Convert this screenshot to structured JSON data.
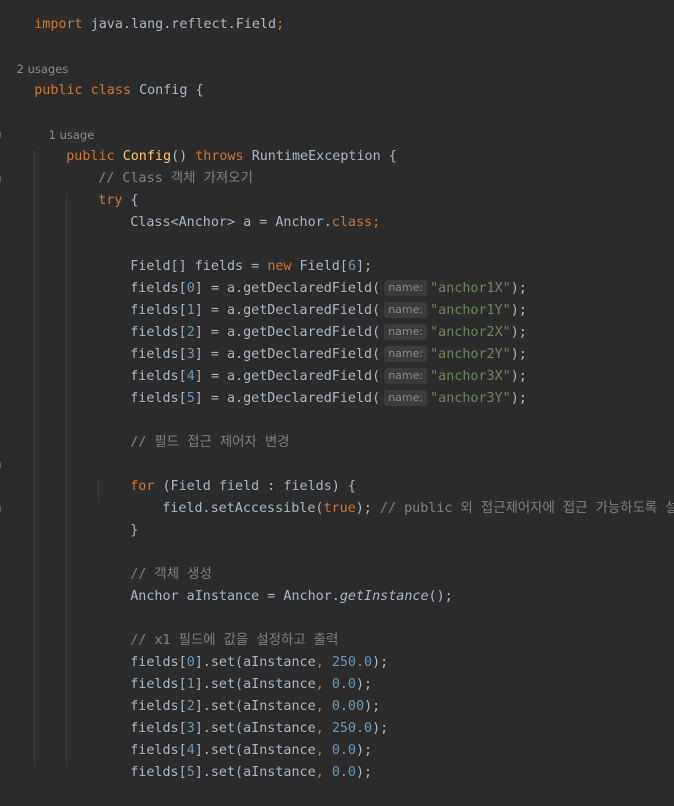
{
  "code": {
    "import_kw": "import",
    "import_path": "java.lang.reflect.Field",
    "import_semi": ";",
    "usages_class": "2 usages",
    "class_decl_kw": "public class",
    "class_name": "Config",
    "class_brace": "{",
    "usages_ctor": "1 usage",
    "ctor_public": "public",
    "ctor_name": "Config",
    "ctor_parens": "()",
    "ctor_throws": "throws",
    "ctor_exception": "RuntimeException {",
    "comment_get_class": "// Class 객체 가져오기",
    "try_kw": "try",
    "try_brace": "{",
    "class_line": "Class<Anchor> a = Anchor.",
    "class_kw": "class",
    "semi": ";",
    "fields_decl": "Field[] fields = ",
    "new_kw": "new",
    "fields_new": " Field[",
    "fields_size": "6",
    "fields_end": "];",
    "param_hint": "name:",
    "declared_fields": [
      {
        "prefix": "fields[",
        "index": "0",
        "mid": "] = a.getDeclaredField(",
        "arg": "\"anchor1X\"",
        "end": ");"
      },
      {
        "prefix": "fields[",
        "index": "1",
        "mid": "] = a.getDeclaredField(",
        "arg": "\"anchor1Y\"",
        "end": ");"
      },
      {
        "prefix": "fields[",
        "index": "2",
        "mid": "] = a.getDeclaredField(",
        "arg": "\"anchor2X\"",
        "end": ");"
      },
      {
        "prefix": "fields[",
        "index": "3",
        "mid": "] = a.getDeclaredField(",
        "arg": "\"anchor2Y\"",
        "end": ");"
      },
      {
        "prefix": "fields[",
        "index": "4",
        "mid": "] = a.getDeclaredField(",
        "arg": "\"anchor3X\"",
        "end": ");"
      },
      {
        "prefix": "fields[",
        "index": "5",
        "mid": "] = a.getDeclaredField(",
        "arg": "\"anchor3Y\"",
        "end": ");"
      }
    ],
    "comment_access": "// 필드 접근 제어자 변경",
    "for_kw": "for",
    "for_rest": " (Field field : fields) {",
    "set_accessible": "field.setAccessible(",
    "true_kw": "true",
    "set_accessible_end": ");",
    "comment_accessible": " // public 외 접근제어자에 접근 가능하도록 설정",
    "close_brace": "}",
    "comment_instance": "// 객체 생성",
    "instance_start": "Anchor aInstance = Anchor.",
    "instance_method": "getInstance",
    "instance_end": "();",
    "comment_set": "// x1 필드에 값을 설정하고 출력",
    "set_lines": [
      {
        "prefix": "fields[",
        "index": "0",
        "mid": "].set(aInstance",
        "comma": ", ",
        "value": "250.0",
        "end": ");"
      },
      {
        "prefix": "fields[",
        "index": "1",
        "mid": "].set(aInstance",
        "comma": ", ",
        "value": "0.0",
        "end": ");"
      },
      {
        "prefix": "fields[",
        "index": "2",
        "mid": "].set(aInstance",
        "comma": ", ",
        "value": "0.00",
        "end": ");"
      },
      {
        "prefix": "fields[",
        "index": "3",
        "mid": "].set(aInstance",
        "comma": ", ",
        "value": "250.0",
        "end": ");"
      },
      {
        "prefix": "fields[",
        "index": "4",
        "mid": "].set(aInstance",
        "comma": ", ",
        "value": "0.0",
        "end": ");"
      },
      {
        "prefix": "fields[",
        "index": "5",
        "mid": "].set(aInstance",
        "comma": ", ",
        "value": "0.0",
        "end": ");"
      }
    ]
  },
  "colors": {
    "background": "#2b2b2b",
    "keyword": "#cc7832",
    "function": "#ffc66d",
    "string": "#6a8759",
    "number": "#6897bb",
    "comment": "#808080",
    "text": "#a9b7c6"
  }
}
